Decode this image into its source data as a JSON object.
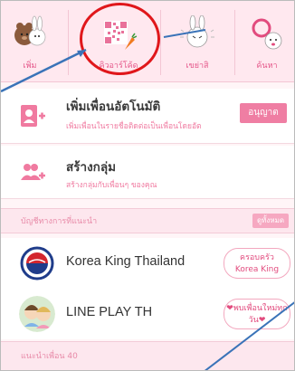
{
  "tabs": [
    {
      "label": "เพิ่ม",
      "icon": "bear-bunny-icon"
    },
    {
      "label": "คิวอาร์โค้ด",
      "icon": "qr-code-icon"
    },
    {
      "label": "เขย่าสิ",
      "icon": "shake-bunny-icon"
    },
    {
      "label": "ค้นหา",
      "icon": "search-bunny-icon"
    }
  ],
  "auto_add": {
    "title": "เพิ่มเพื่อนอัตโนมัติ",
    "subtitle": "เพิ่มเพื่อนในรายชื่อติดต่อเป็นเพื่อนโดยอัต",
    "button": "อนุญาต"
  },
  "create_group": {
    "title": "สร้างกลุ่ม",
    "subtitle": "สร้างกลุ่มกับเพื่อนๆ ของคุณ"
  },
  "recommended": {
    "header": "บัญชีทางการที่แนะนำ",
    "view_all": "ดูทั้งหมด",
    "accounts": [
      {
        "name": "Korea King Thailand",
        "badge_line1": "ครอบครัว",
        "badge_line2": "Korea King"
      },
      {
        "name": "LINE PLAY TH",
        "badge_line1": "❤พบเพื่อนใหม่ทุก",
        "badge_line2": "วัน❤"
      }
    ]
  },
  "suggested_friends": {
    "header": "แนะนำเพื่อน 40"
  },
  "colors": {
    "accent_pink": "#ef7ea3",
    "highlight_red": "#e0171b",
    "annotation_blue": "#3a73b8"
  }
}
